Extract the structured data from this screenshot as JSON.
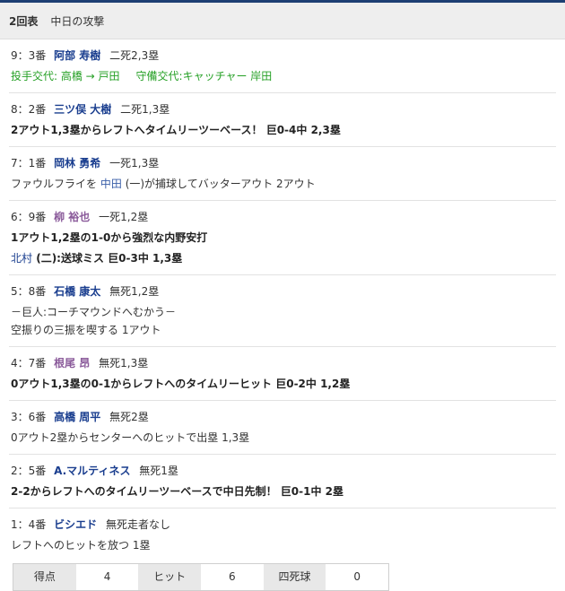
{
  "header": {
    "inning": "2回表",
    "attack": "中日の攻撃"
  },
  "plays": [
    {
      "seq": "9：3番",
      "batter": "阿部 寿樹",
      "situation": "二死2,3塁",
      "sub": {
        "pitcher_label": "投手交代: 高橋 → 戸田",
        "catcher_label": "守備交代:キャッチャー 岸田"
      }
    },
    {
      "seq": "8：2番",
      "batter": "三ツ俣 大樹",
      "situation": "二死1,3塁",
      "result": "2アウト1,3塁からレフトへタイムリーツーベース！ 巨0-4中 2,3塁"
    },
    {
      "seq": "7：1番",
      "batter": "岡林 勇希",
      "situation": "一死1,3塁",
      "result_pre": "ファウルフライを",
      "fielder": "中田",
      "result_post": "(一)が捕球してバッターアウト 2アウト"
    },
    {
      "seq": "6：9番",
      "batter": "柳 裕也",
      "situation": "一死1,2塁",
      "result": "1アウト1,2塁の1-0から強烈な内野安打",
      "extra_fielder": "北村",
      "extra_rest": "(二):送球ミス 巨0-3中 1,3塁"
    },
    {
      "seq": "5：8番",
      "batter": "石橋 康太",
      "situation": "無死1,2塁",
      "note": "－巨人:コーチマウンドへむかう－",
      "result": "空振りの三振を喫する 1アウト"
    },
    {
      "seq": "4：7番",
      "batter": "根尾 昂",
      "situation": "無死1,3塁",
      "result": "0アウト1,3塁の0-1からレフトへのタイムリーヒット 巨0-2中 1,2塁"
    },
    {
      "seq": "3：6番",
      "batter": "高橋 周平",
      "situation": "無死2塁",
      "result": "0アウト2塁からセンターへのヒットで出塁 1,3塁"
    },
    {
      "seq": "2：5番",
      "batter": "A.マルティネス",
      "situation": "無死1塁",
      "result": "2-2からレフトへのタイムリーツーベースで中日先制！ 巨0-1中 2塁"
    },
    {
      "seq": "1：4番",
      "batter": "ビシエド",
      "situation": "無死走者なし",
      "result": "レフトへのヒットを放つ 1塁"
    }
  ],
  "summary": {
    "runs_label": "得点",
    "runs": "4",
    "hits_label": "ヒット",
    "hits": "6",
    "walks_label": "四死球",
    "walks": "0"
  }
}
